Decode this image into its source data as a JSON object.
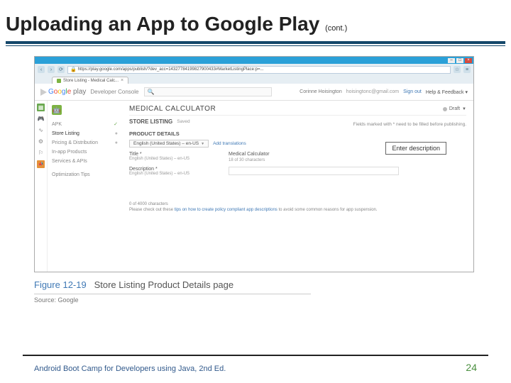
{
  "slide": {
    "title": "Uploading an App to Google Play",
    "cont": "(cont.)",
    "footer": "Android Boot Camp for Developers using Java, 2nd Ed.",
    "number": "24"
  },
  "browser": {
    "url": "https://play.google.com/apps/publish/?dev_acc=14327784199827900433#MarketListingPlace:p=...",
    "tab_label": "Store Listing - Medical Calc..."
  },
  "gp": {
    "logo_google": "Google",
    "logo_play": "play",
    "dev_console": "Developer Console",
    "user_name": "Corinne Hoisington",
    "user_email": "hoisingtonc@gmail.com",
    "sign_out": "Sign out",
    "help": "Help & Feedback",
    "app_title": "MEDICAL CALCULATOR",
    "draft": "Draft",
    "section": "STORE LISTING",
    "section_status": "Saved",
    "required_hint": "Fields marked with * need to be filled before publishing.",
    "product_details": "PRODUCT DETAILS",
    "lang_label": "English (United States) – en-US",
    "add_translations": "Add translations",
    "nav": {
      "apk": "APK",
      "store_listing": "Store Listing",
      "pricing": "Pricing & Distribution",
      "inapp": "In-app Products",
      "services": "Services & APIs",
      "tips": "Optimization Tips"
    },
    "fields": {
      "title_label": "Title *",
      "title_sub": "English (United States) – en-US",
      "title_value": "Medical Calculator",
      "title_counter": "18 of 30 characters",
      "desc_label": "Description *",
      "desc_sub": "English (United States) – en-US",
      "desc_counter": "0 of 4000 characters",
      "desc_tip_pre": "Please check out these ",
      "desc_tip_link": "tips on how to create policy compliant app descriptions",
      "desc_tip_post": " to avoid some common reasons for app suspension."
    }
  },
  "callout": {
    "text": "Enter description"
  },
  "figure": {
    "num": "Figure 12-19",
    "desc": "Store Listing Product Details page",
    "source": "Source: Google"
  }
}
